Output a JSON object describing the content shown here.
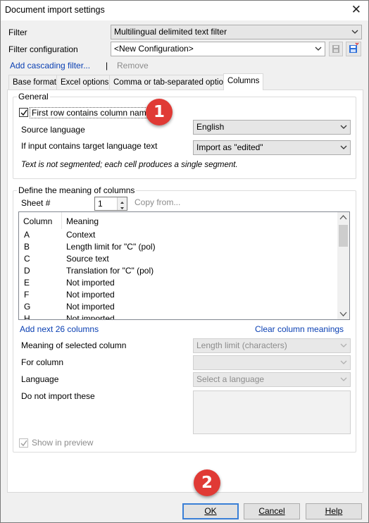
{
  "window": {
    "title": "Document import settings"
  },
  "filter": {
    "label": "Filter",
    "value": "Multilingual delimited text filter"
  },
  "filter_configuration": {
    "label": "Filter configuration",
    "value": "<New Configuration>"
  },
  "cascading": {
    "add_label": "Add cascading filter...",
    "separator": "|",
    "remove_label": "Remove"
  },
  "tabs": [
    {
      "label": "Base format"
    },
    {
      "label": "Excel options"
    },
    {
      "label": "Comma or tab-separated options"
    },
    {
      "label": "Columns",
      "active": true
    }
  ],
  "general": {
    "title": "General",
    "first_row": {
      "label": "First row contains column names",
      "checked": true
    },
    "source_language": {
      "label": "Source language",
      "value": "English"
    },
    "target_language_text": {
      "label": "If input contains target language text",
      "value": "Import as \"edited\""
    },
    "note": "Text is not segmented; each cell produces a single segment."
  },
  "columns": {
    "title": "Define the meaning of columns",
    "sheet_label": "Sheet #",
    "sheet_value": "1",
    "copy_from": "Copy from...",
    "headers": {
      "column": "Column",
      "meaning": "Meaning"
    },
    "rows": [
      {
        "column": "A",
        "meaning": "Context"
      },
      {
        "column": "B",
        "meaning": "Length limit for \"C\" (pol)"
      },
      {
        "column": "C",
        "meaning": "Source text"
      },
      {
        "column": "D",
        "meaning": "Translation for \"C\" (pol)"
      },
      {
        "column": "E",
        "meaning": "Not imported"
      },
      {
        "column": "F",
        "meaning": "Not imported"
      },
      {
        "column": "G",
        "meaning": "Not imported"
      },
      {
        "column": "H",
        "meaning": "Not imported"
      }
    ],
    "add_next": "Add next 26 columns",
    "clear": "Clear column meanings",
    "meaning_selected": {
      "label": "Meaning of selected column",
      "value": "Length limit (characters)"
    },
    "for_column": {
      "label": "For column",
      "value": ""
    },
    "language": {
      "label": "Language",
      "value": "Select a language"
    },
    "do_not_import": {
      "label": "Do not import these"
    },
    "show_in_preview": {
      "label": "Show in preview",
      "checked": true
    }
  },
  "buttons": {
    "ok": "OK",
    "cancel": "Cancel",
    "help": "Help"
  },
  "annotations": {
    "badge1": "1",
    "badge2": "2",
    "badge_color": "#e03a35"
  }
}
